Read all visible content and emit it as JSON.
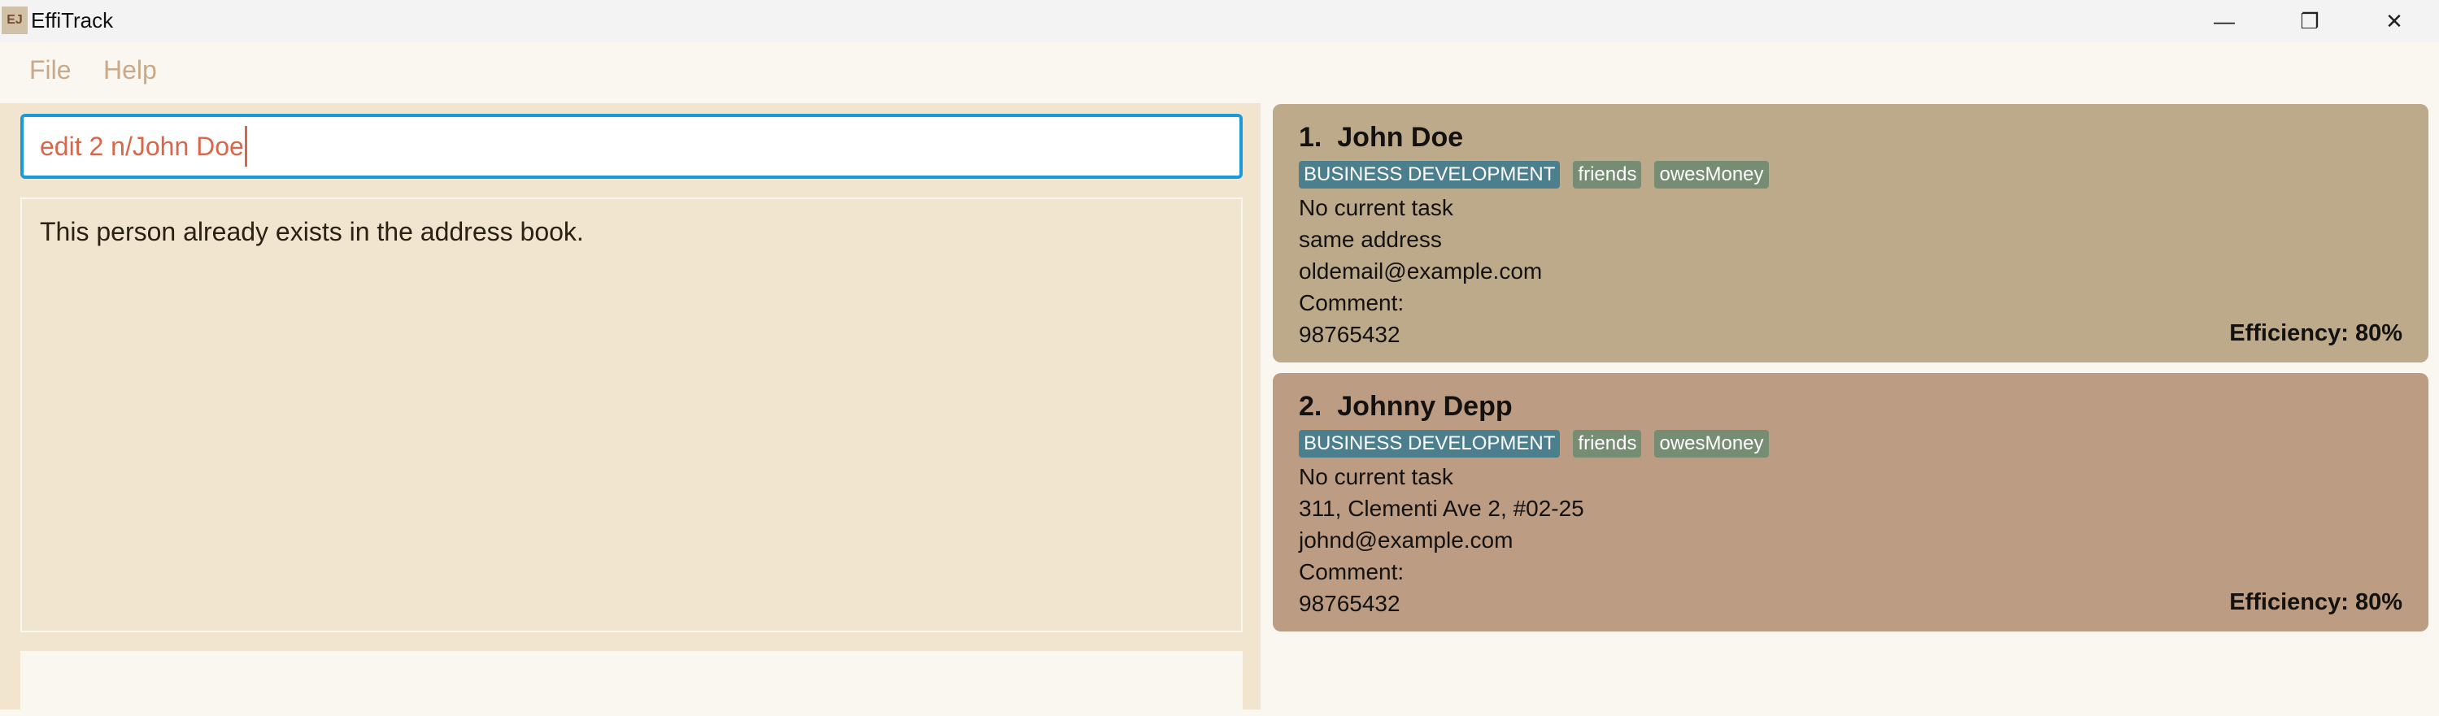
{
  "window": {
    "title": "EffiTrack",
    "icon_text": "EJ"
  },
  "menu": [
    "File",
    "Help"
  ],
  "command_input": {
    "value": "edit 2 n/John Doe"
  },
  "result_message": "This person already exists in the address book.",
  "colors": {
    "card1": "#bcaa8b",
    "card2": "#bc9c82",
    "dept_tag": "#4c7f8e",
    "tag": "#768c73",
    "input_border": "#1a9ad6"
  },
  "persons": [
    {
      "index": "1.",
      "name": "John Doe",
      "department": "BUSINESS DEVELOPMENT",
      "tags": [
        "friends",
        "owesMoney"
      ],
      "task": "No current task",
      "address": "same address",
      "email": "oldemail@example.com",
      "comment": "Comment:",
      "phone": "98765432",
      "efficiency": "Efficiency: 80%"
    },
    {
      "index": "2.",
      "name": "Johnny Depp",
      "department": "BUSINESS DEVELOPMENT",
      "tags": [
        "friends",
        "owesMoney"
      ],
      "task": "No current task",
      "address": "311, Clementi Ave 2, #02-25",
      "email": "johnd@example.com",
      "comment": "Comment:",
      "phone": "98765432",
      "efficiency": "Efficiency: 80%"
    }
  ]
}
